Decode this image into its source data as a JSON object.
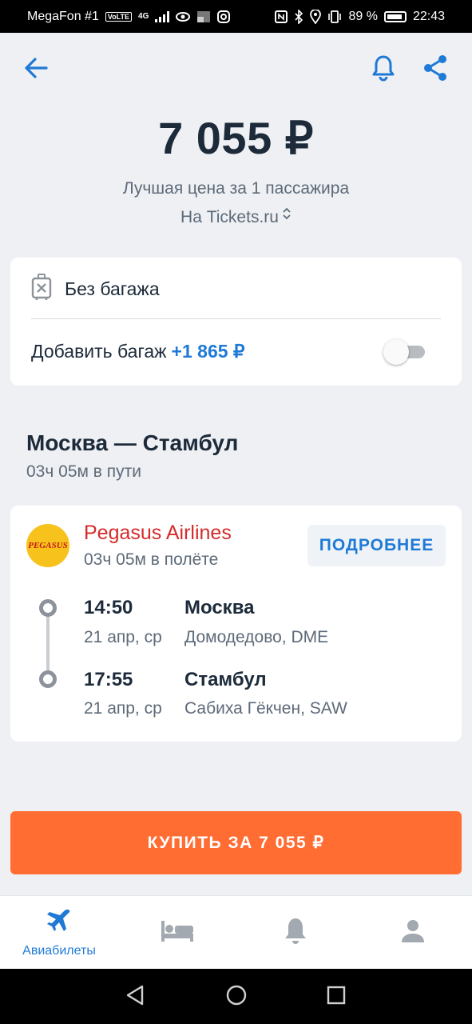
{
  "status_bar": {
    "carrier": "MegaFon #1",
    "volte": "VoLTE",
    "network": "4G",
    "battery": "89 %",
    "time": "22:43"
  },
  "header": {
    "back_icon": "arrow-left-icon",
    "bell_icon": "bell-icon",
    "share_icon": "share-icon"
  },
  "price": {
    "amount": "7 055 ₽",
    "caption": "Лучшая цена за 1 пассажира",
    "source": "На Tickets.ru",
    "source_icon": "chevron-up-down-icon"
  },
  "baggage": {
    "icon": "no-luggage-icon",
    "status": "Без багажа",
    "add_label": "Добавить багаж",
    "add_price": "+1 865 ₽",
    "toggle_on": false
  },
  "route": {
    "title": "Москва — Стамбул",
    "duration": "03ч 05м в пути"
  },
  "flight": {
    "airline": "Pegasus Airlines",
    "logo_text": "PEGASUS",
    "flight_duration": "03ч 05м в полёте",
    "details_label": "ПОДРОБНЕЕ",
    "departure": {
      "time": "14:50",
      "date": "21 апр, ср",
      "city": "Москва",
      "airport": "Домодедово, DME"
    },
    "arrival": {
      "time": "17:55",
      "date": "21 апр, ср",
      "city": "Стамбул",
      "airport": "Сабиха Гёкчен, SAW"
    }
  },
  "buy_button": "КУПИТЬ ЗА 7 055 ₽",
  "bottom_nav": {
    "items": [
      {
        "icon": "airplane-icon",
        "label": "Авиабилеты",
        "active": true
      },
      {
        "icon": "bed-icon",
        "active": false
      },
      {
        "icon": "bell-icon",
        "active": false
      },
      {
        "icon": "profile-icon",
        "active": false
      }
    ]
  },
  "colors": {
    "accent": "#1f7ad6",
    "buy": "#ff6d33",
    "airline": "#d52b2b",
    "background": "#eef0f4"
  }
}
